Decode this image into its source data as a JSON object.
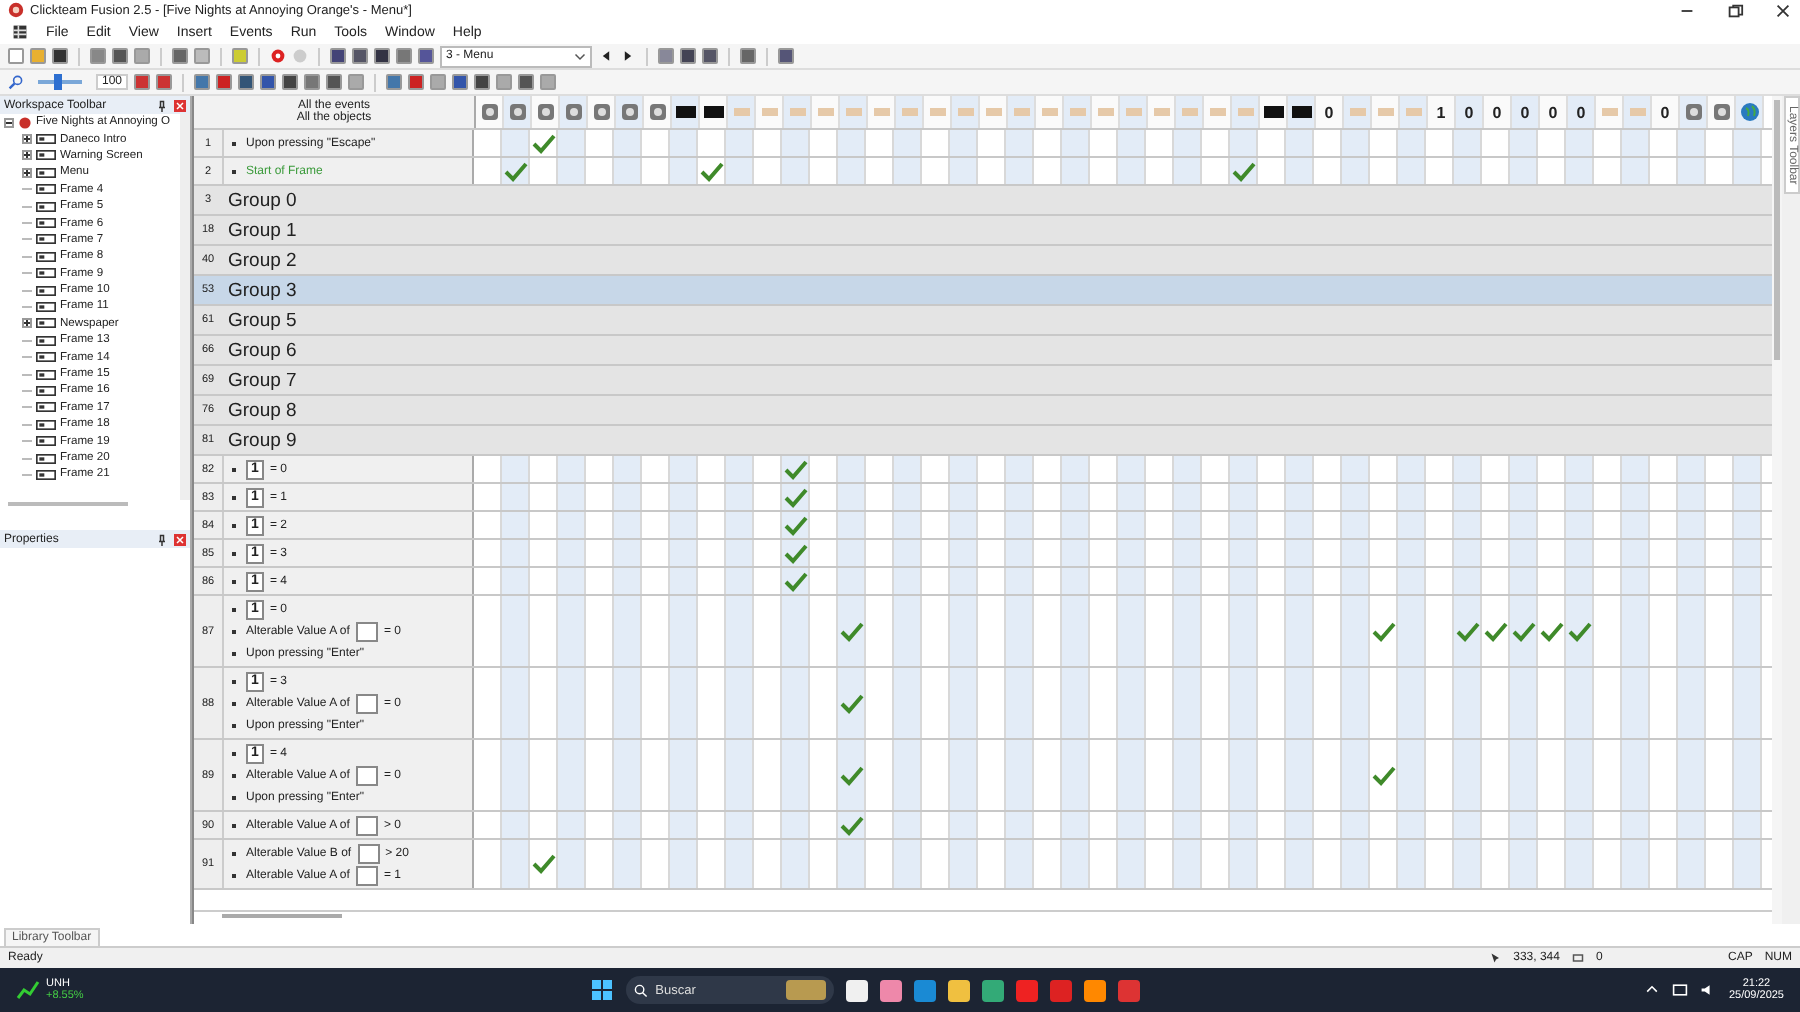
{
  "window": {
    "title": "Clickteam Fusion 2.5 - [Five Nights at Annoying Orange's - Menu*]"
  },
  "menu": [
    "File",
    "Edit",
    "View",
    "Insert",
    "Events",
    "Run",
    "Tools",
    "Window",
    "Help"
  ],
  "toolbar": {
    "frame_select": "3 - Menu",
    "zoom": {
      "value": "100",
      "level": 0.45
    }
  },
  "workspace": {
    "title": "Workspace Toolbar",
    "tree": [
      {
        "label": "Five Nights at Annoying O",
        "expanded": true,
        "children": [
          {
            "label": "Daneco Intro",
            "expanded": false
          },
          {
            "label": "Warning Screen",
            "expanded": false
          },
          {
            "label": "Menu",
            "expanded": false
          },
          {
            "label": "Frame 4"
          },
          {
            "label": "Frame 5"
          },
          {
            "label": "Frame 6"
          },
          {
            "label": "Frame 7"
          },
          {
            "label": "Frame 8"
          },
          {
            "label": "Frame 9"
          },
          {
            "label": "Frame 10"
          },
          {
            "label": "Frame 11"
          },
          {
            "label": "Newspaper",
            "expanded": false
          },
          {
            "label": "Frame 13"
          },
          {
            "label": "Frame 14"
          },
          {
            "label": "Frame 15"
          },
          {
            "label": "Frame 16"
          },
          {
            "label": "Frame 17"
          },
          {
            "label": "Frame 18"
          },
          {
            "label": "Frame 19"
          },
          {
            "label": "Frame 20"
          },
          {
            "label": "Frame 21"
          }
        ]
      }
    ]
  },
  "properties": {
    "title": "Properties"
  },
  "library_tab": "Library Toolbar",
  "layers_tab": "Layers Toolbar",
  "events": {
    "header": [
      "All the events",
      "All the objects"
    ],
    "columns": [
      {
        "kind": "icon"
      },
      {
        "kind": "icon"
      },
      {
        "kind": "icon"
      },
      {
        "kind": "icon"
      },
      {
        "kind": "icon"
      },
      {
        "kind": "icon"
      },
      {
        "kind": "icon"
      },
      {
        "kind": "dark"
      },
      {
        "kind": "dark"
      },
      {
        "kind": "faint"
      },
      {
        "kind": "faint"
      },
      {
        "kind": "faint"
      },
      {
        "kind": "faint"
      },
      {
        "kind": "faint"
      },
      {
        "kind": "faint"
      },
      {
        "kind": "faint"
      },
      {
        "kind": "faint"
      },
      {
        "kind": "faint"
      },
      {
        "kind": "faint"
      },
      {
        "kind": "faint"
      },
      {
        "kind": "faint"
      },
      {
        "kind": "faint"
      },
      {
        "kind": "faint"
      },
      {
        "kind": "faint"
      },
      {
        "kind": "faint"
      },
      {
        "kind": "faint"
      },
      {
        "kind": "faint"
      },
      {
        "kind": "faint"
      },
      {
        "kind": "dark"
      },
      {
        "kind": "dark"
      },
      {
        "kind": "counter",
        "label": "0"
      },
      {
        "kind": "faint"
      },
      {
        "kind": "faint"
      },
      {
        "kind": "faint"
      },
      {
        "kind": "counter",
        "label": "1"
      },
      {
        "kind": "counter",
        "label": "0"
      },
      {
        "kind": "counter",
        "label": "0"
      },
      {
        "kind": "counter",
        "label": "0"
      },
      {
        "kind": "counter",
        "label": "0"
      },
      {
        "kind": "counter",
        "label": "0"
      },
      {
        "kind": "faint"
      },
      {
        "kind": "faint"
      },
      {
        "kind": "counter",
        "label": "0"
      },
      {
        "kind": "icon"
      },
      {
        "kind": "icon"
      },
      {
        "kind": "globe"
      }
    ],
    "rows": [
      {
        "kind": "event",
        "number": "1",
        "lines": [
          {
            "kind": "plain",
            "text": "Upon pressing \"Escape\""
          }
        ],
        "marks": [
          false,
          false,
          true,
          false,
          false,
          false,
          false,
          false,
          false,
          false,
          false,
          false,
          false,
          false,
          false,
          false,
          false,
          false,
          false,
          false,
          false,
          false,
          false,
          false,
          false,
          false,
          false,
          false,
          false,
          false,
          false,
          false,
          false,
          false,
          false,
          false,
          false,
          false,
          false,
          false,
          false,
          false,
          false,
          false,
          false,
          false
        ]
      },
      {
        "kind": "event",
        "number": "2",
        "lines": [
          {
            "kind": "start",
            "text": "Start of Frame"
          }
        ],
        "marks": [
          false,
          true,
          false,
          false,
          false,
          false,
          false,
          false,
          true,
          false,
          false,
          false,
          false,
          false,
          false,
          false,
          false,
          false,
          false,
          false,
          false,
          false,
          false,
          false,
          false,
          false,
          false,
          true,
          false,
          false,
          false,
          false,
          false,
          false,
          false,
          false,
          false,
          false,
          false,
          false,
          false,
          false,
          false,
          false,
          false,
          false
        ]
      },
      {
        "kind": "group",
        "number": "3",
        "title": "Group 0",
        "selected": false
      },
      {
        "kind": "group",
        "number": "18",
        "title": "Group 1",
        "selected": false
      },
      {
        "kind": "group",
        "number": "40",
        "title": "Group 2",
        "selected": false
      },
      {
        "kind": "group",
        "number": "53",
        "title": "Group 3",
        "selected": true
      },
      {
        "kind": "group",
        "number": "61",
        "title": "Group 5",
        "selected": false
      },
      {
        "kind": "group",
        "number": "66",
        "title": "Group 6",
        "selected": false
      },
      {
        "kind": "group",
        "number": "69",
        "title": "Group 7",
        "selected": false
      },
      {
        "kind": "group",
        "number": "76",
        "title": "Group 8",
        "selected": false
      },
      {
        "kind": "group",
        "number": "81",
        "title": "Group 9",
        "selected": false
      },
      {
        "kind": "event",
        "number": "82",
        "lines": [
          {
            "kind": "counter",
            "object": "1",
            "after": "= 0"
          }
        ],
        "marks": [
          false,
          false,
          false,
          false,
          false,
          false,
          false,
          false,
          false,
          false,
          false,
          true,
          false,
          false,
          false,
          false,
          false,
          false,
          false,
          false,
          false,
          false,
          false,
          false,
          false,
          false,
          false,
          false,
          false,
          false,
          false,
          false,
          false,
          false,
          false,
          false,
          false,
          false,
          false,
          false,
          false,
          false,
          false,
          false,
          false,
          false
        ]
      },
      {
        "kind": "event",
        "number": "83",
        "lines": [
          {
            "kind": "counter",
            "object": "1",
            "after": "= 1"
          }
        ],
        "marks": [
          false,
          false,
          false,
          false,
          false,
          false,
          false,
          false,
          false,
          false,
          false,
          true,
          false,
          false,
          false,
          false,
          false,
          false,
          false,
          false,
          false,
          false,
          false,
          false,
          false,
          false,
          false,
          false,
          false,
          false,
          false,
          false,
          false,
          false,
          false,
          false,
          false,
          false,
          false,
          false,
          false,
          false,
          false,
          false,
          false,
          false
        ]
      },
      {
        "kind": "event",
        "number": "84",
        "lines": [
          {
            "kind": "counter",
            "object": "1",
            "after": "= 2"
          }
        ],
        "marks": [
          false,
          false,
          false,
          false,
          false,
          false,
          false,
          false,
          false,
          false,
          false,
          true,
          false,
          false,
          false,
          false,
          false,
          false,
          false,
          false,
          false,
          false,
          false,
          false,
          false,
          false,
          false,
          false,
          false,
          false,
          false,
          false,
          false,
          false,
          false,
          false,
          false,
          false,
          false,
          false,
          false,
          false,
          false,
          false,
          false,
          false
        ]
      },
      {
        "kind": "event",
        "number": "85",
        "lines": [
          {
            "kind": "counter",
            "object": "1",
            "after": "= 3"
          }
        ],
        "marks": [
          false,
          false,
          false,
          false,
          false,
          false,
          false,
          false,
          false,
          false,
          false,
          true,
          false,
          false,
          false,
          false,
          false,
          false,
          false,
          false,
          false,
          false,
          false,
          false,
          false,
          false,
          false,
          false,
          false,
          false,
          false,
          false,
          false,
          false,
          false,
          false,
          false,
          false,
          false,
          false,
          false,
          false,
          false,
          false,
          false,
          false
        ]
      },
      {
        "kind": "event",
        "number": "86",
        "lines": [
          {
            "kind": "counter",
            "object": "1",
            "after": "= 4"
          }
        ],
        "marks": [
          false,
          false,
          false,
          false,
          false,
          false,
          false,
          false,
          false,
          false,
          false,
          true,
          false,
          false,
          false,
          false,
          false,
          false,
          false,
          false,
          false,
          false,
          false,
          false,
          false,
          false,
          false,
          false,
          false,
          false,
          false,
          false,
          false,
          false,
          false,
          false,
          false,
          false,
          false,
          false,
          false,
          false,
          false,
          false,
          false,
          false
        ]
      },
      {
        "kind": "event",
        "number": "87",
        "lines": [
          {
            "kind": "counter",
            "object": "1",
            "after": "= 0"
          },
          {
            "kind": "value",
            "text": "Alterable Value A of",
            "after": "= 0"
          },
          {
            "kind": "plain",
            "text": "Upon pressing \"Enter\""
          }
        ],
        "marks": [
          false,
          false,
          false,
          false,
          false,
          false,
          false,
          false,
          false,
          false,
          false,
          false,
          false,
          true,
          false,
          false,
          false,
          false,
          false,
          false,
          false,
          false,
          false,
          false,
          false,
          false,
          false,
          false,
          false,
          false,
          false,
          false,
          true,
          false,
          false,
          true,
          true,
          true,
          true,
          true,
          false,
          false,
          false,
          false,
          false,
          false
        ]
      },
      {
        "kind": "event",
        "number": "88",
        "lines": [
          {
            "kind": "counter",
            "object": "1",
            "after": "= 3"
          },
          {
            "kind": "value",
            "text": "Alterable Value A of",
            "after": "= 0"
          },
          {
            "kind": "plain",
            "text": "Upon pressing \"Enter\""
          }
        ],
        "marks": [
          false,
          false,
          false,
          false,
          false,
          false,
          false,
          false,
          false,
          false,
          false,
          false,
          false,
          true,
          false,
          false,
          false,
          false,
          false,
          false,
          false,
          false,
          false,
          false,
          false,
          false,
          false,
          false,
          false,
          false,
          false,
          false,
          false,
          false,
          false,
          false,
          false,
          false,
          false,
          false,
          false,
          false,
          false,
          false,
          false,
          false
        ]
      },
      {
        "kind": "event",
        "number": "89",
        "lines": [
          {
            "kind": "counter",
            "object": "1",
            "after": "= 4"
          },
          {
            "kind": "value",
            "text": "Alterable Value A of",
            "after": "= 0"
          },
          {
            "kind": "plain",
            "text": "Upon pressing \"Enter\""
          }
        ],
        "marks": [
          false,
          false,
          false,
          false,
          false,
          false,
          false,
          false,
          false,
          false,
          false,
          false,
          false,
          true,
          false,
          false,
          false,
          false,
          false,
          false,
          false,
          false,
          false,
          false,
          false,
          false,
          false,
          false,
          false,
          false,
          false,
          false,
          true,
          false,
          false,
          false,
          false,
          false,
          false,
          false,
          false,
          false,
          false,
          false,
          false,
          false
        ]
      },
      {
        "kind": "event",
        "number": "90",
        "lines": [
          {
            "kind": "value",
            "text": "Alterable Value A of",
            "after": "> 0"
          }
        ],
        "marks": [
          false,
          false,
          false,
          false,
          false,
          false,
          false,
          false,
          false,
          false,
          false,
          false,
          false,
          true,
          false,
          false,
          false,
          false,
          false,
          false,
          false,
          false,
          false,
          false,
          false,
          false,
          false,
          false,
          false,
          false,
          false,
          false,
          false,
          false,
          false,
          false,
          false,
          false,
          false,
          false,
          false,
          false,
          false,
          false,
          false,
          false
        ]
      },
      {
        "kind": "event",
        "number": "91",
        "lines": [
          {
            "kind": "value",
            "text": "Alterable Value B of",
            "after": "> 20"
          },
          {
            "kind": "value",
            "text": "Alterable Value A of",
            "after": "= 1"
          }
        ],
        "marks": [
          false,
          false,
          true,
          false,
          false,
          false,
          false,
          false,
          false,
          false,
          false,
          false,
          false,
          false,
          false,
          false,
          false,
          false,
          false,
          false,
          false,
          false,
          false,
          false,
          false,
          false,
          false,
          false,
          false,
          false,
          false,
          false,
          false,
          false,
          false,
          false,
          false,
          false,
          false,
          false,
          false,
          false,
          false,
          false,
          false,
          false
        ]
      }
    ]
  },
  "status_bar": {
    "state": "Ready",
    "coords": "333, 344",
    "count": "0",
    "caps": "CAP",
    "num": "NUM"
  },
  "taskbar": {
    "stock": {
      "symbol": "UNH",
      "change": "+8.55%"
    },
    "search": {
      "placeholder": "Buscar"
    },
    "time": "21:22",
    "date": "25/09/2025"
  }
}
